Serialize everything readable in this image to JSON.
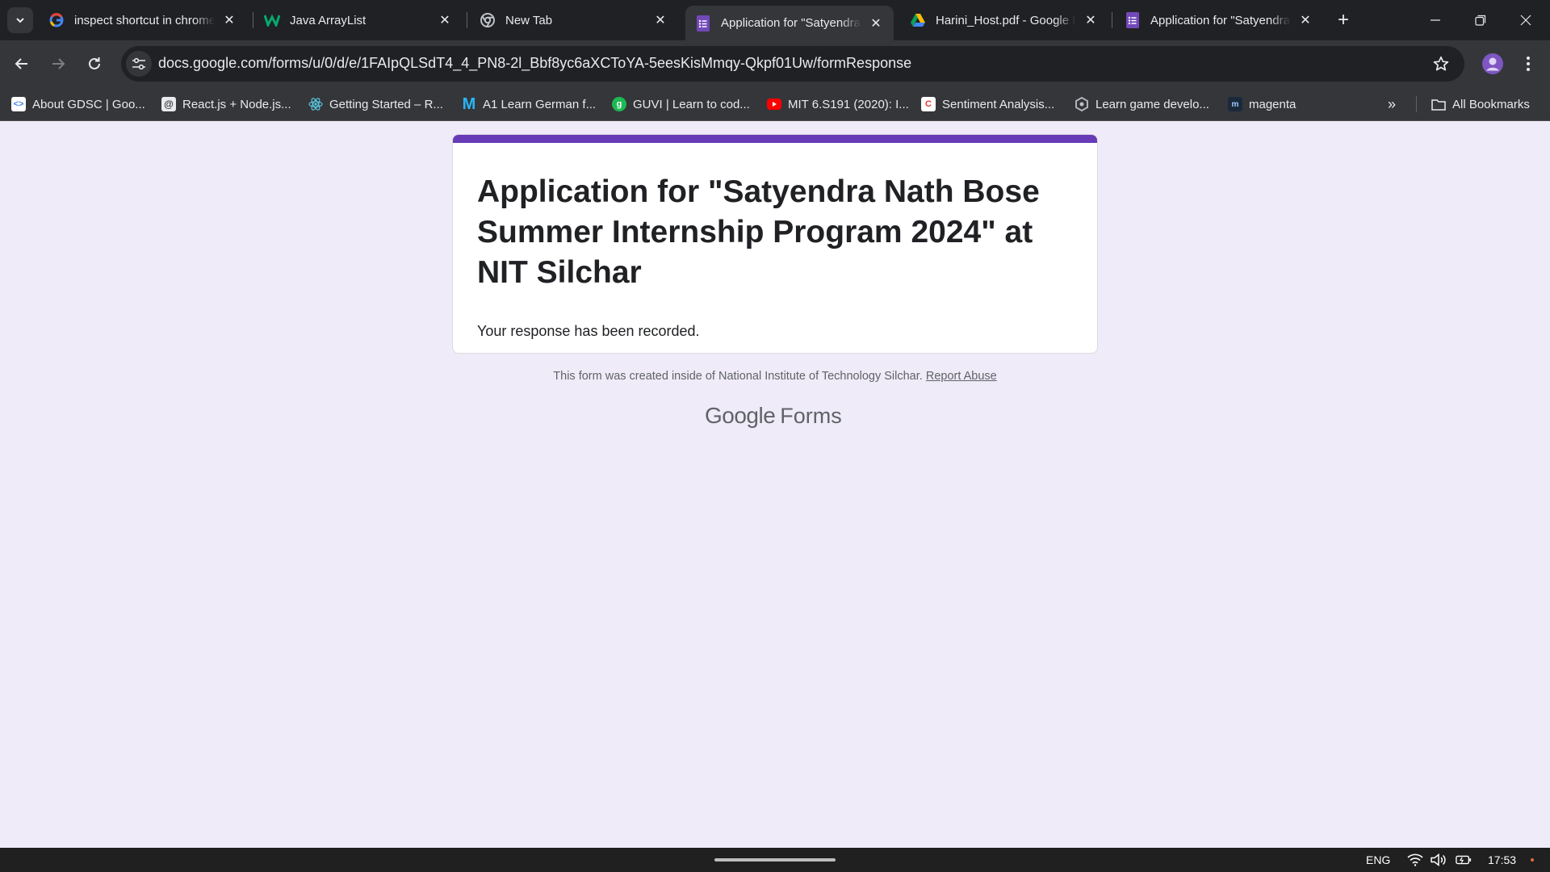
{
  "browser": {
    "tabs": [
      {
        "title": "inspect shortcut in chrome",
        "icon": "google-icon",
        "active": false
      },
      {
        "title": "Java ArrayList",
        "icon": "w3schools-icon",
        "active": false
      },
      {
        "title": "New Tab",
        "icon": "chrome-icon",
        "active": false
      },
      {
        "title": "Application for \"Satyendra",
        "icon": "google-forms-icon",
        "active": true
      },
      {
        "title": "Harini_Host.pdf - Google Drive",
        "icon": "google-drive-icon",
        "active": false
      },
      {
        "title": "Application for \"Satyendra",
        "icon": "google-forms-icon",
        "active": false
      }
    ],
    "new_tab_label": "+",
    "url": "docs.google.com/forms/u/0/d/e/1FAIpQLSdT4_4_PN8-2l_Bbf8yc6aXCToYA-5eesKisMmqy-Qkpf01Uw/formResponse",
    "bookmarks": [
      {
        "label": "About GDSC | Goo...",
        "icon": "gdsc-icon"
      },
      {
        "label": "React.js + Node.js...",
        "icon": "react-node-icon"
      },
      {
        "label": "Getting Started – R...",
        "icon": "react-icon"
      },
      {
        "label": "A1 Learn German f...",
        "icon": "m-logo-icon"
      },
      {
        "label": "GUVI | Learn to cod...",
        "icon": "guvi-icon"
      },
      {
        "label": "MIT 6.S191 (2020): I...",
        "icon": "youtube-icon"
      },
      {
        "label": "Sentiment Analysis...",
        "icon": "sentiment-icon"
      },
      {
        "label": "Learn game develo...",
        "icon": "game-dev-icon"
      },
      {
        "label": "magenta",
        "icon": "magenta-icon"
      }
    ],
    "all_bookmarks_label": "All Bookmarks"
  },
  "form": {
    "title": "Application for \"Satyendra Nath Bose Summer Internship Program 2024\" at NIT Silchar",
    "confirmation": "Your response has been recorded.",
    "footer_text": "This form was created inside of National Institute of Technology Silchar.",
    "report_abuse": "Report Abuse",
    "brand_google": "Google",
    "brand_forms": "Forms",
    "accent_color": "#673ab7"
  },
  "taskbar": {
    "language": "ENG",
    "time": "17:53"
  }
}
